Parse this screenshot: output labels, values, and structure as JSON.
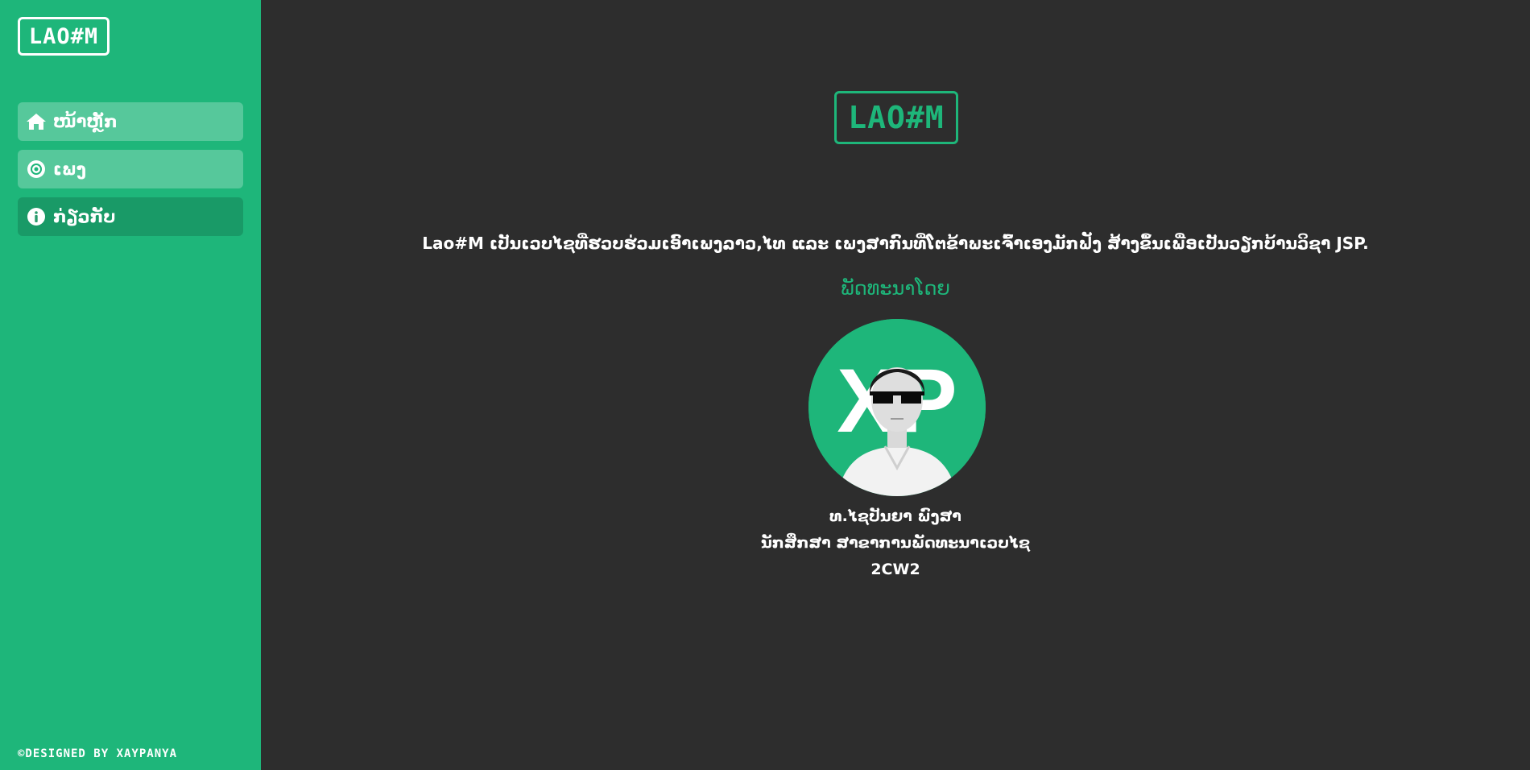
{
  "sidebar": {
    "logo": "LAO#M",
    "items": [
      {
        "label": "ໜ້າຫຼັກ",
        "icon": "home-icon"
      },
      {
        "label": "ເພງ",
        "icon": "disc-icon"
      },
      {
        "label": "ກ່ຽວກັບ",
        "icon": "info-icon"
      }
    ],
    "footer": "©DESIGNED BY XAYPANYA"
  },
  "main": {
    "logo": "LAO#M",
    "description": "Lao#M ເປັນເວບໄຊທີ່ຮວບຮ່ວມເອົາເພງລາວ,ໄທ ແລະ ເພງສາກົນທີ່ໂຕຂ້າພະເຈົ້າເອງມັກຟັງ ສ້າງຂຶ້ນເພື່ອເປັນວຽກບ້ານວິຊາ JSP.",
    "developed_by": "ພັດທະນາໂດຍ",
    "avatar_text": "XP",
    "developer_name": "ທ.ໄຊປັນຍາ ພົງສາ",
    "developer_role": "ນັກສຶກສາ ສາຂາການພັດທະນາເວບໄຊ",
    "developer_class": "2CW2"
  },
  "colors": {
    "accent": "#1eb67a",
    "background": "#2d2d2d"
  }
}
